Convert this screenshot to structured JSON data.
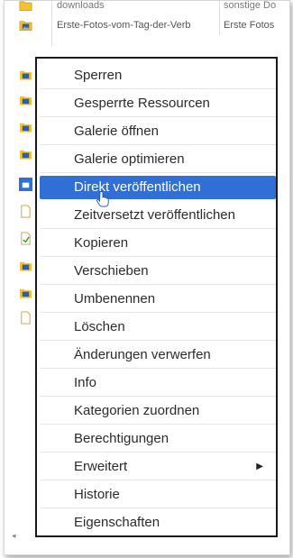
{
  "background": {
    "rows": [
      {
        "name": "downloads",
        "type": "sonstige Do",
        "icon": "folder-icon"
      },
      {
        "name": "Erste-Fotos-vom-Tag-der-Verb",
        "type": "Erste Fotos",
        "icon": "gallery-folder-icon"
      }
    ]
  },
  "context_menu": {
    "items": [
      {
        "label": "Sperren"
      },
      {
        "label": "Gesperrte Ressourcen"
      },
      {
        "label": "Galerie öffnen"
      },
      {
        "label": "Galerie optimieren"
      },
      {
        "label": "Direkt veröffentlichen",
        "state": "highlighted"
      },
      {
        "label": "Zeitversetzt veröffentlichen"
      },
      {
        "label": "Kopieren"
      },
      {
        "label": "Verschieben"
      },
      {
        "label": "Umbenennen"
      },
      {
        "label": "Löschen"
      },
      {
        "label": "Änderungen verwerfen"
      },
      {
        "label": "Info"
      },
      {
        "label": "Kategorien zuordnen"
      },
      {
        "label": "Berechtigungen"
      },
      {
        "label": "Erweitert",
        "has_submenu": true,
        "submenu_icon": "triangle-right-icon"
      },
      {
        "label": "Historie"
      },
      {
        "label": "Eigenschaften"
      }
    ]
  },
  "colors": {
    "highlight": "#2f6fd6",
    "menu_border": "#1a1a1a",
    "folder": "#f2c230",
    "image_icon": "#2f5ea8"
  }
}
